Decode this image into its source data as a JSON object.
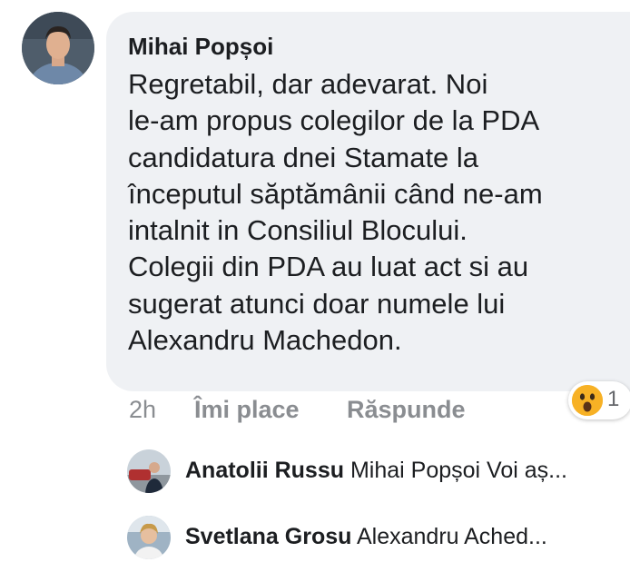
{
  "comment": {
    "author": "Mihai Popșoi",
    "lines": [
      "Regretabil, dar adevarat. Noi",
      "le-am propus colegilor de la PDA",
      "candidatura dnei Stamate la",
      "începutul săptămânii când ne-am",
      "intalnit in Consiliul Blocului.",
      "Colegii din PDA au luat act si au",
      "sugerat atunci doar numele lui",
      "Alexandru Machedon."
    ],
    "time": "2h",
    "like_label": "Îmi place",
    "reply_label": "Răspunde",
    "reaction_count": "1",
    "reaction_icon": "wow-emoji-icon"
  },
  "replies": [
    {
      "author": "Anatolii Russu",
      "preview": "Mihai Popșoi Voi aș..."
    },
    {
      "author": "Svetlana Grosu",
      "preview": "Alexandru Ached..."
    }
  ]
}
